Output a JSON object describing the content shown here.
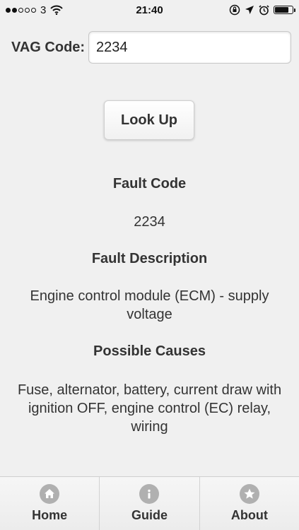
{
  "status_bar": {
    "carrier": "3",
    "time": "21:40",
    "signal_strength_of_5": 2,
    "battery_level_pct": 80
  },
  "form": {
    "label": "VAG Code:",
    "value": "2234",
    "lookup_label": "Look Up"
  },
  "result": {
    "fault_code_heading": "Fault Code",
    "fault_code": "2234",
    "fault_description_heading": "Fault Description",
    "fault_description": "Engine control module (ECM) - supply voltage",
    "possible_causes_heading": "Possible Causes",
    "possible_causes": "Fuse, alternator, battery, current draw with ignition OFF, engine control (EC) relay, wiring"
  },
  "tabs": [
    {
      "label": "Home",
      "icon": "home-icon"
    },
    {
      "label": "Guide",
      "icon": "info-icon"
    },
    {
      "label": "About",
      "icon": "star-icon"
    }
  ],
  "colors": {
    "background": "#f0f0f0",
    "text": "#333333",
    "icon_gray": "#b0b0b0"
  }
}
